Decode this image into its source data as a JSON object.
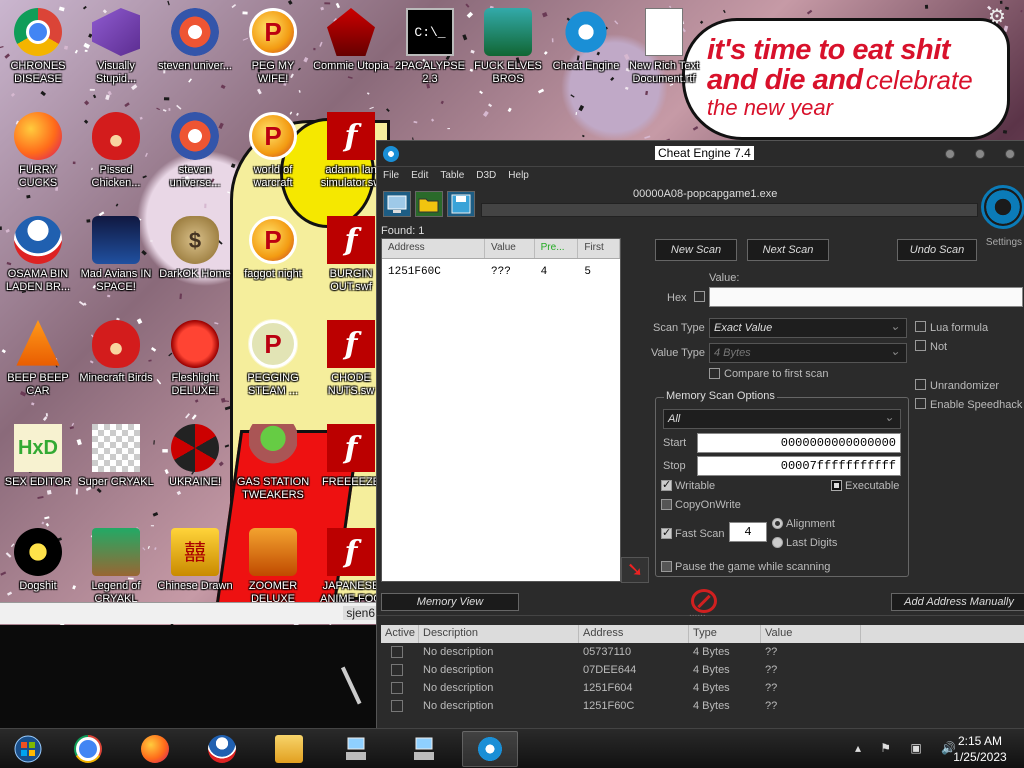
{
  "desktop": {
    "bubble": {
      "line1": "it's time to eat shit",
      "line2a": "and die and",
      "line2b": "celebrate",
      "line3": "the new year"
    },
    "background_window_title": "sjen6",
    "icons": [
      {
        "label": "CHRONES DISEASE",
        "icon": "chrome-icon"
      },
      {
        "label": "Visually Stupid...",
        "icon": "visual-studio-icon"
      },
      {
        "label": "steven univer...",
        "icon": "steven-universe-icon"
      },
      {
        "label": "PEG MY WIFE!",
        "icon": "peggle-icon"
      },
      {
        "label": "Commie Utopia",
        "icon": "commie-icon"
      },
      {
        "label": "2PACALYPSE 2.3",
        "icon": "cmd-icon"
      },
      {
        "label": "FUCK ELVES BROS",
        "icon": "elves-icon"
      },
      {
        "label": "Cheat Engine",
        "icon": "cheat-engine-icon"
      },
      {
        "label": "New Rich Text Document.rtf",
        "icon": "document-icon"
      },
      {
        "label": "FURRY CUCKS",
        "icon": "firefox-icon"
      },
      {
        "label": "Pissed Chicken...",
        "icon": "angry-birds-seasons-icon"
      },
      {
        "label": "steven universe...",
        "icon": "steven-gem-icon"
      },
      {
        "label": "world of warcraft",
        "icon": "peggle-icon"
      },
      {
        "label": "adamn lan simulator.sw",
        "icon": "flash-icon"
      },
      {
        "label": "OSAMA BIN LADEN BR...",
        "icon": "obama-icon"
      },
      {
        "label": "Mad Avians IN SPACE!",
        "icon": "angry-birds-space-icon"
      },
      {
        "label": "DarkOK Home",
        "icon": "money-bag-icon"
      },
      {
        "label": "faggot night",
        "icon": "peggle-nights-icon"
      },
      {
        "label": "BURGIN OUT.swf",
        "icon": "flash-icon"
      },
      {
        "label": "BEEP BEEP CAR",
        "icon": "vlc-icon"
      },
      {
        "label": "Minecraft Birds",
        "icon": "angry-birds-icon"
      },
      {
        "label": "Fleshlight DELUXE!",
        "icon": "fleshlight-icon"
      },
      {
        "label": "PEGGING STEAM ...",
        "icon": "peggle-icon"
      },
      {
        "label": "CHODE NUTS.sw",
        "icon": "flash-icon"
      },
      {
        "label": "SEX EDITOR",
        "icon": "hxd-icon"
      },
      {
        "label": "Super CRYAKL",
        "icon": "pixel-icon"
      },
      {
        "label": "UKRAINE!",
        "icon": "radiation-icon"
      },
      {
        "label": "GAS STATION TWEAKERS",
        "icon": "plant-icon"
      },
      {
        "label": "FREEEEZE",
        "icon": "flash-icon"
      },
      {
        "label": "Dogshit",
        "icon": "dogshit-icon"
      },
      {
        "label": "Legend of CRYAKL",
        "icon": "gamer-icon"
      },
      {
        "label": "Chinese Drawn",
        "icon": "mahjong-icon"
      },
      {
        "label": "ZOOMER DELUXE",
        "icon": "zoomer-icon"
      },
      {
        "label": "JAPANESE ANIME FOO",
        "icon": "flash-icon"
      }
    ]
  },
  "cheat_engine": {
    "title": "Cheat Engine 7.4",
    "menu": [
      "File",
      "Edit",
      "Table",
      "D3D",
      "Help"
    ],
    "process": "00000A08-popcapgame1.exe",
    "settings_label": "Settings",
    "found_label": "Found: 1",
    "results": {
      "headers": [
        "Address",
        "Value",
        "Pre...",
        "First"
      ],
      "rows": [
        [
          "1251F60C",
          "???",
          "4",
          "5"
        ]
      ]
    },
    "buttons": {
      "new_scan": "New Scan",
      "next_scan": "Next Scan",
      "undo_scan": "Undo Scan",
      "memory_view": "Memory View",
      "add_address": "Add Address Manually"
    },
    "value_label": "Value:",
    "hex_label": "Hex",
    "scan_type_label": "Scan Type",
    "scan_type_value": "Exact Value",
    "value_type_label": "Value Type",
    "value_type_value": "4 Bytes",
    "compare_first": "Compare to first scan",
    "lua_formula": "Lua formula",
    "not_label": "Not",
    "unrandomizer": "Unrandomizer",
    "speedhack": "Enable Speedhack",
    "memory_scan_options": "Memory Scan Options",
    "region": "All",
    "start_label": "Start",
    "start_value": "0000000000000000",
    "stop_label": "Stop",
    "stop_value": "00007fffffffffff",
    "writable": "Writable",
    "executable": "Executable",
    "copy_on_write": "CopyOnWrite",
    "fast_scan": "Fast Scan",
    "fast_scan_value": "4",
    "alignment": "Alignment",
    "last_digits": "Last Digits",
    "pause_game": "Pause the game while scanning",
    "address_table": {
      "headers": [
        "Active",
        "Description",
        "Address",
        "Type",
        "Value"
      ],
      "rows": [
        {
          "description": "No description",
          "address": "05737110",
          "type": "4 Bytes",
          "value": "??"
        },
        {
          "description": "No description",
          "address": "07DEE644",
          "type": "4 Bytes",
          "value": "??"
        },
        {
          "description": "No description",
          "address": "1251F604",
          "type": "4 Bytes",
          "value": "??"
        },
        {
          "description": "No description",
          "address": "1251F60C",
          "type": "4 Bytes",
          "value": "??"
        }
      ]
    }
  },
  "taskbar": {
    "apps": [
      "start-button",
      "chrome-icon",
      "firefox-icon",
      "obama-icon",
      "file-explorer-icon",
      "network-drive-icon",
      "network-drive-icon",
      "cheat-engine-icon"
    ],
    "time": "2:15 AM",
    "date": "1/25/2023"
  },
  "colors": {
    "bubble_text": "#d8112b",
    "ce_background": "#2b2b2b",
    "ce_accent": "#0b7bb8"
  }
}
